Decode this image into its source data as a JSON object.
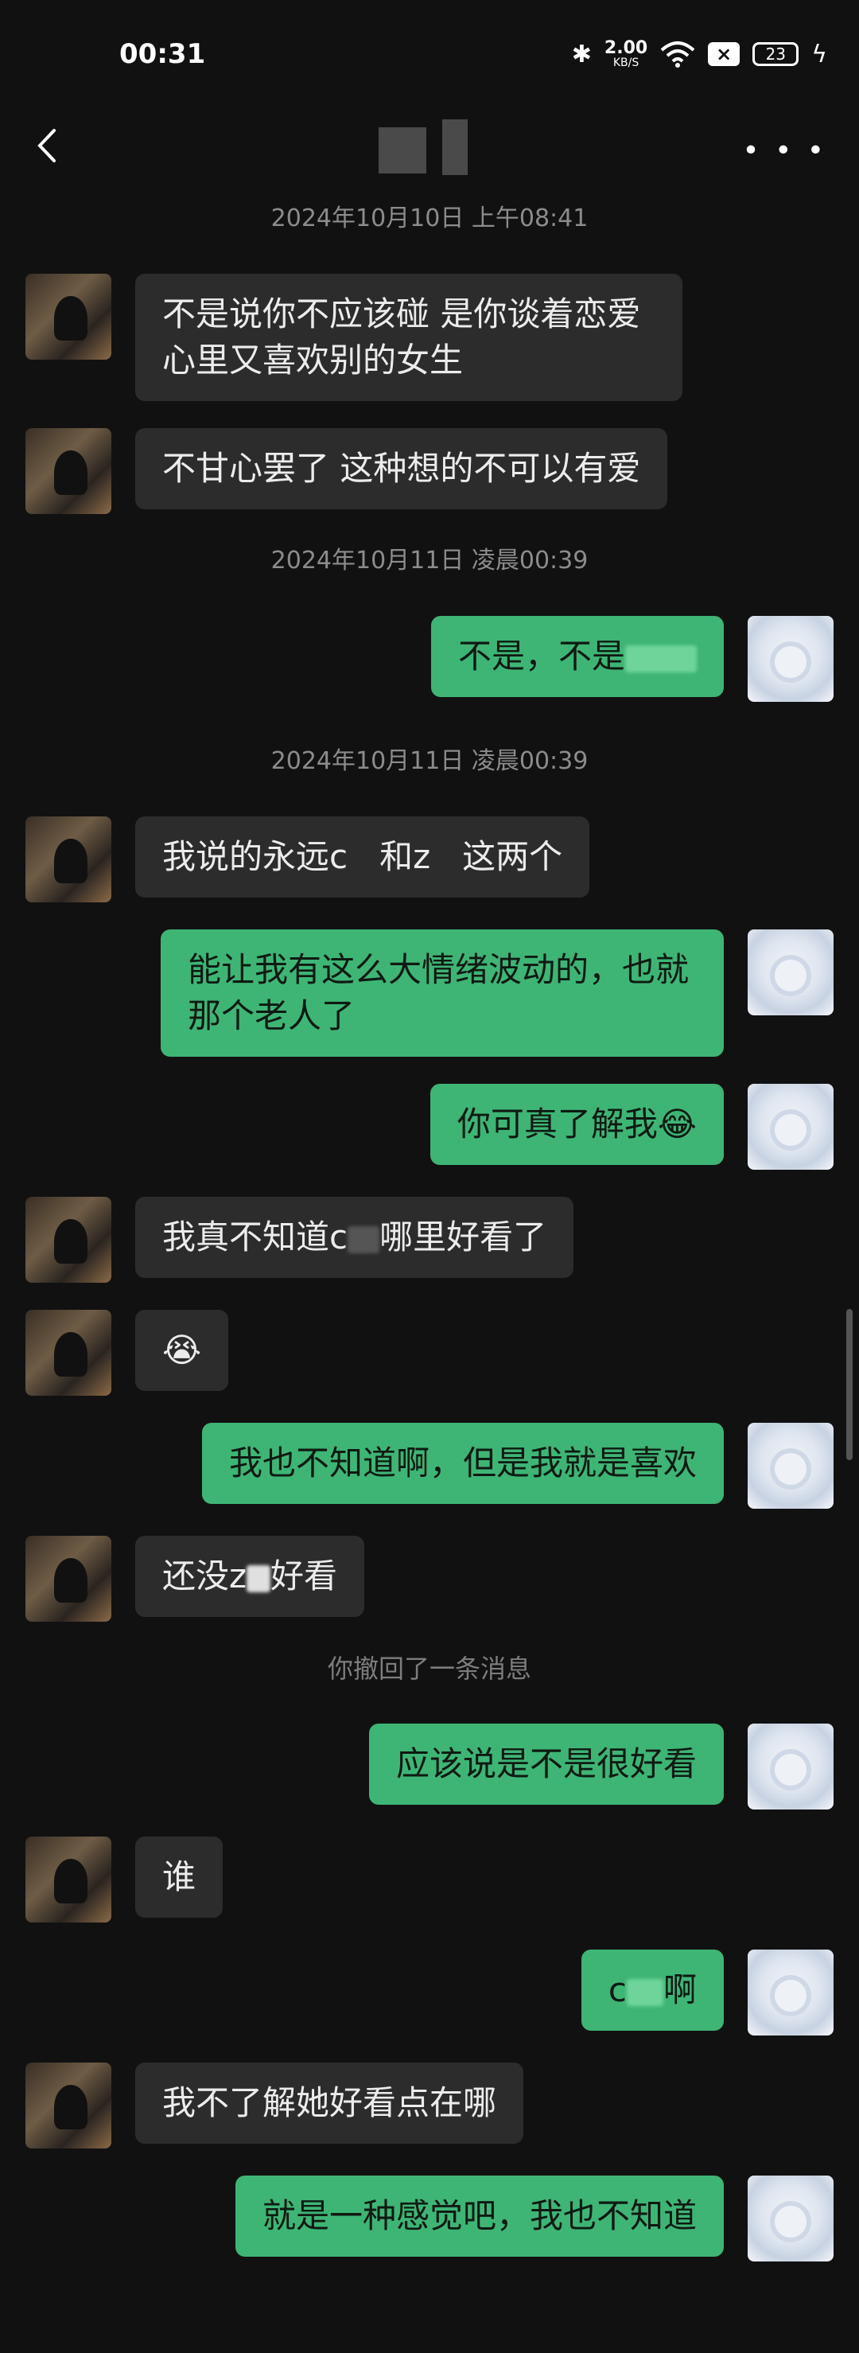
{
  "status": {
    "time": "00:31",
    "net_speed": "2.00",
    "net_unit": "KB/S",
    "battery": "23"
  },
  "header": {
    "more_label": "• • •"
  },
  "chat": {
    "ts1": "2024年10月10日 上午08:41",
    "m1": "不是说你不应该碰 是你谈着恋爱心里又喜欢别的女生",
    "m2": "不甘心罢了 这种想的不可以有爱",
    "ts2": "2024年10月11日 凌晨00:39",
    "m3": "不是，不是",
    "ts3": "2024年10月11日 凌晨00:39",
    "m4a": "我说的永远c",
    "m4b": "和z",
    "m4c": "这两个",
    "m5": "能让我有这么大情绪波动的，也就那个老人了",
    "m6": "你可真了解我😂",
    "m7a": "我真不知道c",
    "m7b": "哪里好看了",
    "m8": "😭",
    "m9": "我也不知道啊，但是我就是喜欢",
    "m10a": "还没z",
    "m10b": "好看",
    "recall": "你撤回了一条消息",
    "m11": "应该说是不是很好看",
    "m12": "谁",
    "m13a": "c",
    "m13b": "啊",
    "m14": "我不了解她好看点在哪",
    "m15": "就是一种感觉吧，我也不知道"
  }
}
